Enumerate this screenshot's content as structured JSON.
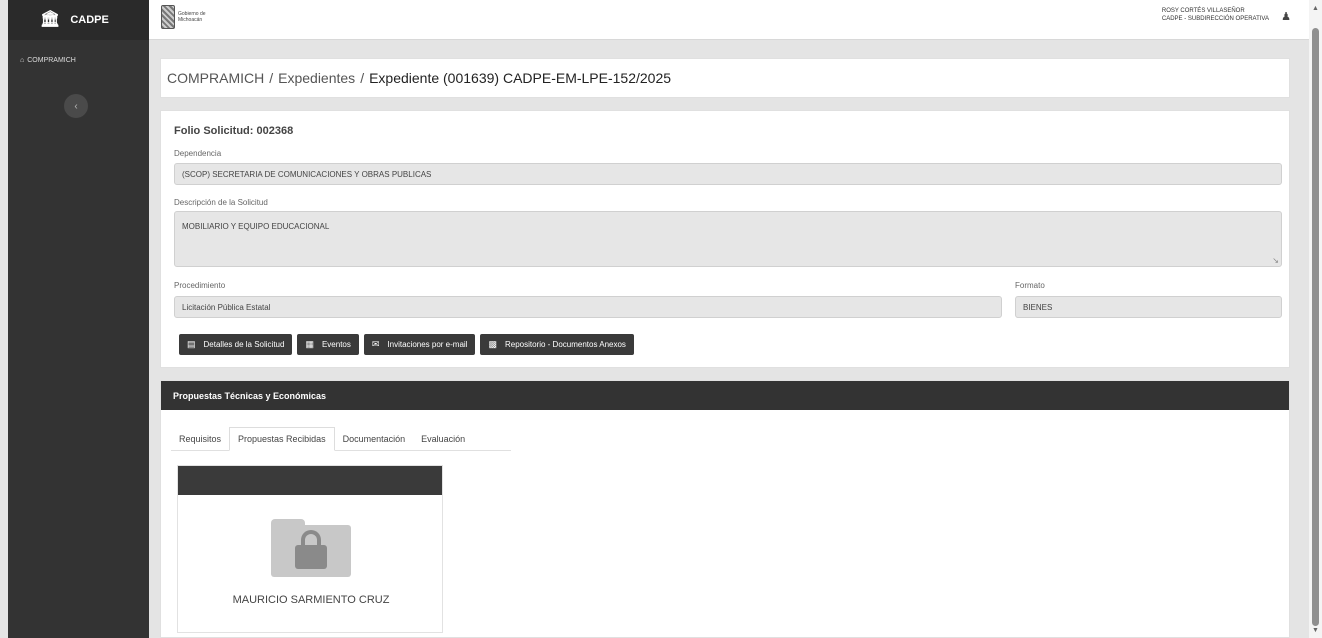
{
  "sidebar": {
    "brand": "CADPE",
    "items": [
      {
        "label": "COMPRAMICH"
      }
    ],
    "collapse_label": "‹"
  },
  "topbar": {
    "gov_logo_text_1": "Gobierno de",
    "gov_logo_text_2": "Michoacán",
    "user_name": "ROSY CORTÉS VILLASEÑOR",
    "user_role": "CADPE - SUBDIRECCIÓN OPERATIVA"
  },
  "breadcrumb": {
    "items": [
      "COMPRAMICH",
      "Expedientes"
    ],
    "current": "Expediente (001639) CADPE-EM-LPE-152/2025"
  },
  "request": {
    "folio_label": "Folio Solicitud: 002368",
    "dependencia_label": "Dependencia",
    "dependencia_value": "(SCOP) SECRETARIA DE COMUNICACIONES Y OBRAS PUBLICAS",
    "descripcion_label": "Descripción de la Solicitud",
    "descripcion_value": "MOBILIARIO Y EQUIPO EDUCACIONAL",
    "procedimiento_label": "Procedimiento",
    "procedimiento_value": "Licitación Pública Estatal",
    "formato_label": "Formato",
    "formato_value": "BIENES"
  },
  "buttons": {
    "detalles": "Detalles de la Solicitud",
    "eventos": "Eventos",
    "invitaciones": "Invitaciones por e-mail",
    "repositorio": "Repositorio - Documentos Anexos"
  },
  "proposals": {
    "header": "Propuestas Técnicas y Económicas",
    "tabs": [
      {
        "label": "Requisitos"
      },
      {
        "label": "Propuestas Recibidas"
      },
      {
        "label": "Documentación"
      },
      {
        "label": "Evaluación"
      }
    ],
    "bidder_name": "MAURICIO SARMIENTO CRUZ"
  },
  "icons": {
    "brand": "bank-icon",
    "user": "user-icon",
    "locked_folder": "lock-folder-icon"
  },
  "colors": {
    "sidebar": "#333333",
    "header_bar": "#333333",
    "button": "#3a3a3a"
  }
}
